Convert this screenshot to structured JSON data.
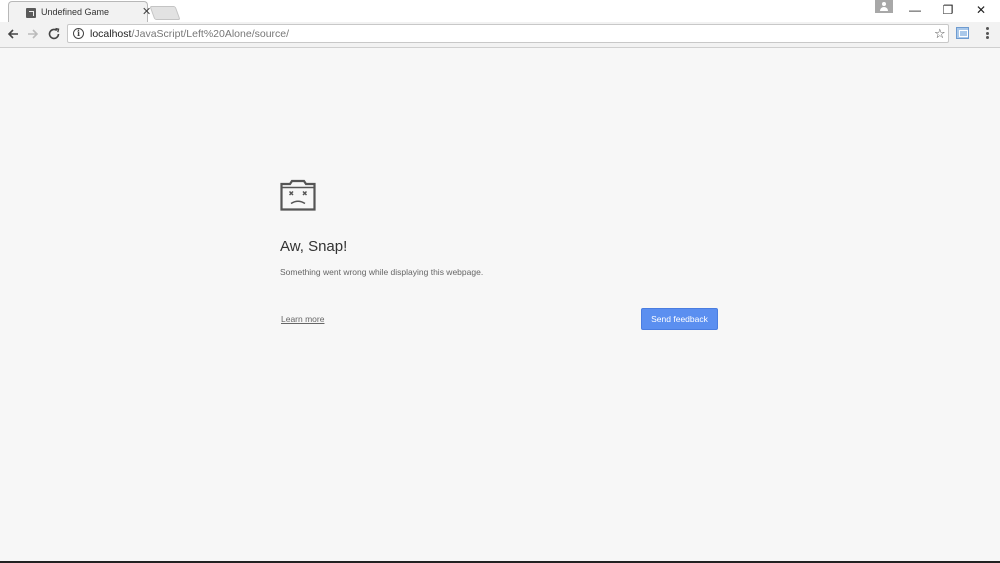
{
  "tab": {
    "title": "Undefined Game",
    "close_glyph": "✕"
  },
  "window_controls": {
    "minimize": "—",
    "restore": "❐",
    "close": "✕"
  },
  "toolbar": {
    "url_host": "localhost",
    "url_path": "/JavaScript/Left%20Alone/source/",
    "star_glyph": "☆",
    "info_glyph": "i"
  },
  "error_page": {
    "heading": "Aw, Snap!",
    "message": "Something went wrong while displaying this webpage.",
    "learn_more": "Learn more",
    "send_feedback": "Send feedback",
    "button_color": "#5b8ff0"
  },
  "icons": {
    "tab_favicon": "page-icon",
    "error_icon": "sad-folder-icon",
    "profile": "person-icon",
    "extension": "extension-icon",
    "menu": "kebab-menu-icon"
  }
}
